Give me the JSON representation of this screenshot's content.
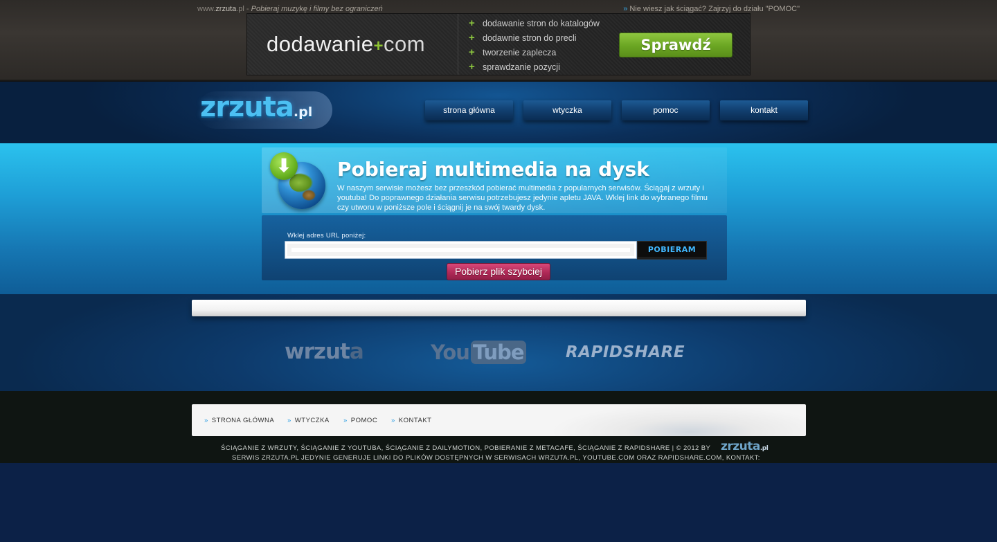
{
  "topbar": {
    "site_prefix": "www.",
    "site_name": "zrzuta",
    "site_suffix": ".pl - ",
    "tagline": "Pobieraj muzykę i filmy bez ograniczeń",
    "help_arrow": "»",
    "help_text": " Nie wiesz jak ściągać? Zajrzyj do działu \"POMOC\""
  },
  "banner": {
    "brand": "dodawanie",
    "brand_plus": "+",
    "brand_tld": "com",
    "items": [
      {
        "icon": "plus-icon",
        "label": "dodawanie stron do katalogów"
      },
      {
        "icon": "plus-icon",
        "label": "dodawnie stron do precli"
      },
      {
        "icon": "plus-icon",
        "label": "tworzenie zaplecza"
      },
      {
        "icon": "plus-icon",
        "label": "sprawdzanie pozycji"
      }
    ],
    "cta": "Sprawdź"
  },
  "header": {
    "logo": "zrzuta",
    "logo_tld": ".pl",
    "nav": [
      "strona główna",
      "wtyczka",
      "pomoc",
      "kontakt"
    ]
  },
  "hero": {
    "title": "Pobieraj multimedia na dysk",
    "intro": "W naszym serwisie możesz bez przeszkód pobierać multimedia z popularnych serwisów. Ściągaj z wrzuty i youtuba! Do poprawnego działania serwisu potrzebujesz jedynie apletu JAVA. Wklej link do wybranego filmu czy utworu w poniższe pole i ściągnij je na swój twardy dysk.",
    "download_icon": "download-arrow-icon",
    "globe_icon": "globe-icon"
  },
  "form": {
    "label": "Wklej adres URL poniżej:",
    "url_value": "",
    "url_placeholder": "",
    "submit": "POBIERAM",
    "fast": "Pobierz plik szybciej"
  },
  "services": {
    "wrzuta": "wrzut",
    "wrzuta_last": "a",
    "youtube_you": "You",
    "youtube_tube": "Tube",
    "rapidshare": "RAPIDSHARE"
  },
  "footer": {
    "nav": [
      "STRONA GŁÓWNA",
      "WTYCZKA",
      "POMOC",
      "KONTAKT"
    ],
    "nav_arrow": "»",
    "legal_line1": "ŚCIĄGANIE Z WRZUTY, ŚCIĄGANIE Z YOUTUBA, ŚCIĄGANIE Z DAILYMOTION, POBIERANIE Z METACAFE, ŚCIĄGANIE Z RAPIDSHARE | © 2012 BY",
    "legal_logo": "zrzuta",
    "legal_logo_tld": ".pl",
    "legal_line2": "SERWIS ZRZUTA.PL JEDYNIE GENERUJE LINKI DO PLIKÓW DOSTĘPNYCH W SERWISACH WRZUTA.PL, YOUTUBE.COM ORAZ RAPIDSHARE.COM, KONTAKT:"
  },
  "colors": {
    "hero_cyan": "#2bc2ee",
    "header_navy": "#0b2f5a",
    "cta_green": "#6aa522",
    "fast_button": "#b02957",
    "link_blue": "#36a9e8"
  }
}
